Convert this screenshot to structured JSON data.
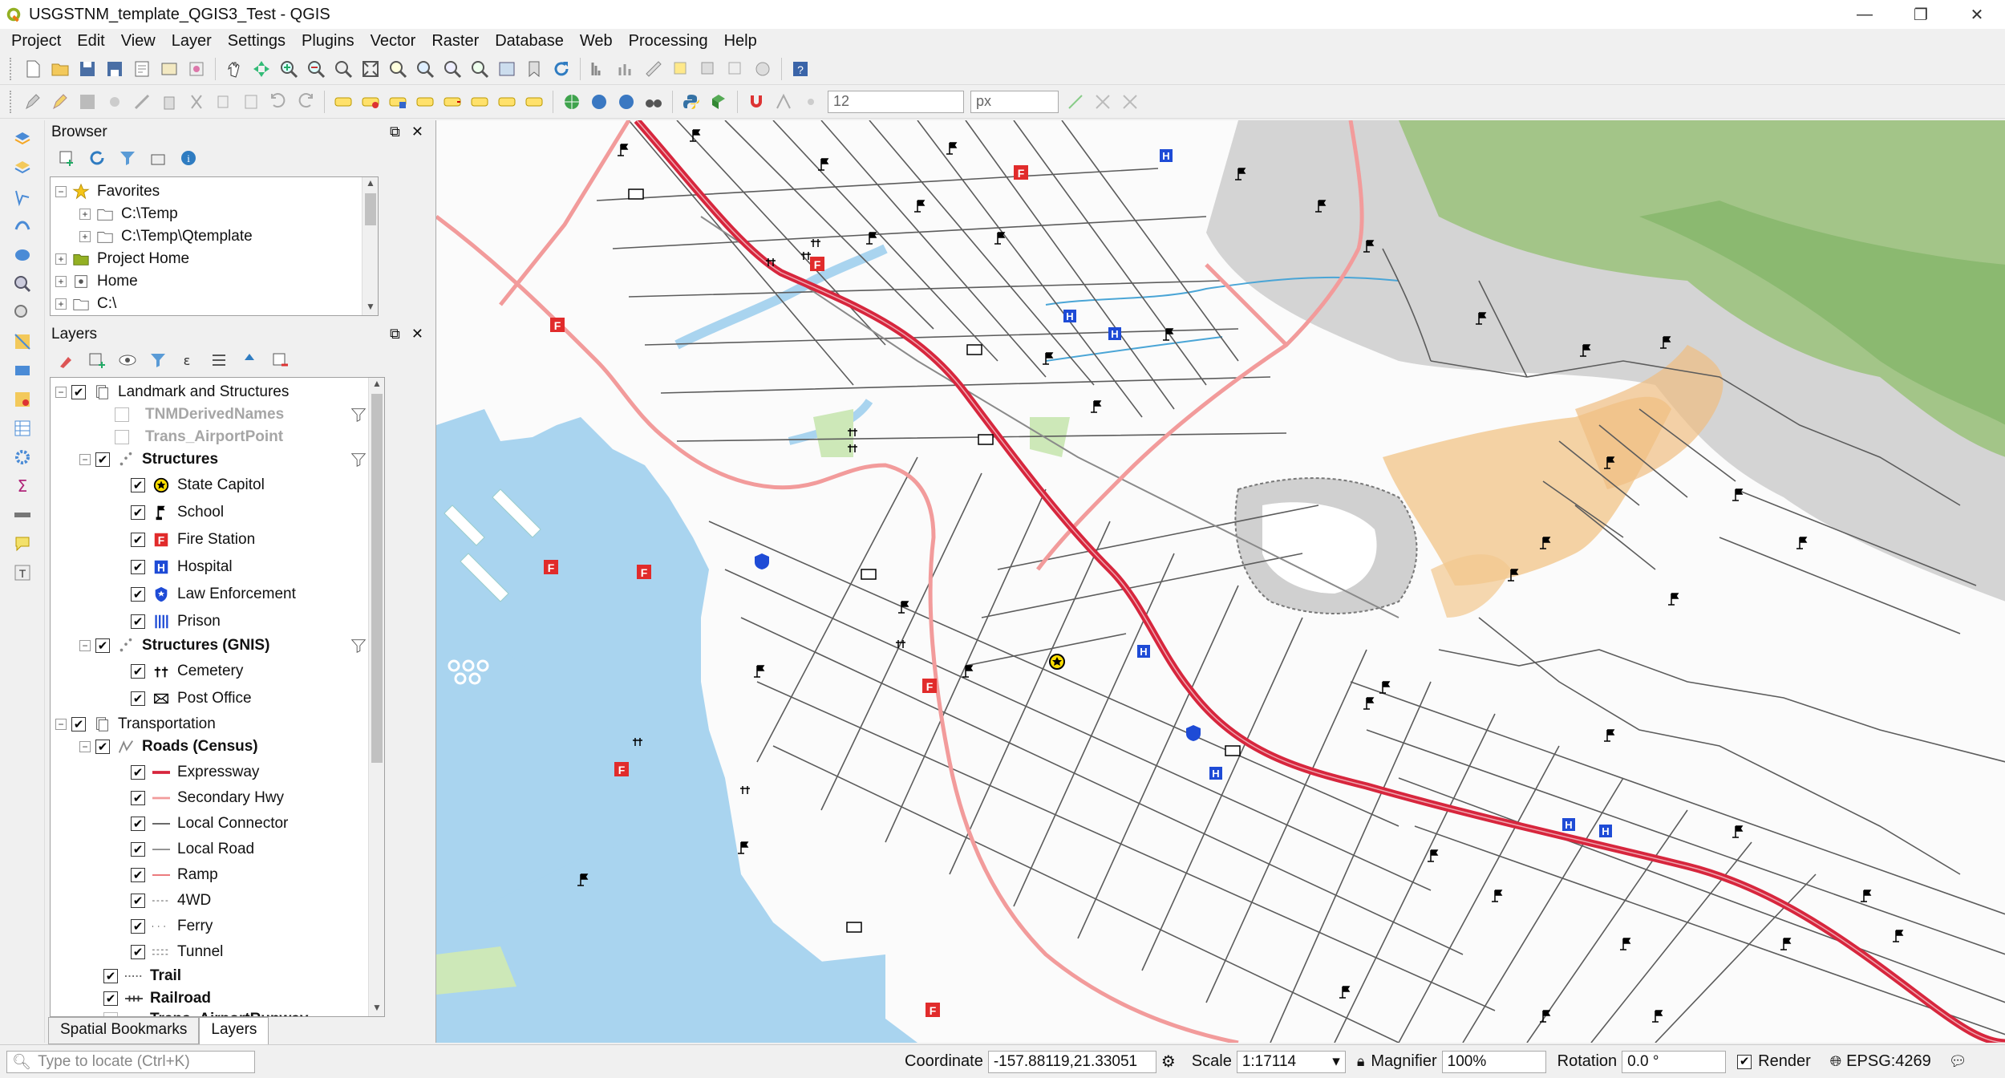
{
  "window": {
    "title": "USGSTNM_template_QGIS3_Test - QGIS",
    "buttons": [
      "minimize",
      "restore",
      "close"
    ]
  },
  "menubar": [
    "Project",
    "Edit",
    "View",
    "Layer",
    "Settings",
    "Plugins",
    "Vector",
    "Raster",
    "Database",
    "Web",
    "Processing",
    "Help"
  ],
  "toolbar2": {
    "snap_tolerance": "12",
    "snap_units": "px"
  },
  "browser": {
    "title": "Browser",
    "items": [
      {
        "label": "Favorites",
        "icon": "star-icon"
      },
      {
        "label": "C:\\Temp",
        "icon": "folder-icon"
      },
      {
        "label": "C:\\Temp\\Qtemplate",
        "icon": "folder-icon"
      },
      {
        "label": "Project Home",
        "icon": "project-home-icon"
      },
      {
        "label": "Home",
        "icon": "home-icon"
      },
      {
        "label": "C:\\",
        "icon": "folder-icon"
      }
    ]
  },
  "layers": {
    "title": "Layers",
    "groups": {
      "landmark": "Landmark and Structures",
      "tnm_derived": "TNMDerivedNames",
      "trans_airport": "Trans_AirportPoint",
      "structures": "Structures",
      "structures_gnis": "Structures (GNIS)",
      "transportation": "Transportation",
      "roads": "Roads (Census)",
      "trail": "Trail",
      "railroad": "Railroad",
      "runway": "Trans_AirportRunway"
    },
    "structures_items": [
      "State Capitol",
      "School",
      "Fire Station",
      "Hospital",
      "Law Enforcement",
      "Prison"
    ],
    "gnis_items": [
      "Cemetery",
      "Post Office"
    ],
    "road_items": [
      "Expressway",
      "Secondary Hwy",
      "Local Connector",
      "Local Road",
      "Ramp",
      "4WD",
      "Ferry",
      "Tunnel"
    ]
  },
  "bottom_tabs": [
    "Spatial Bookmarks",
    "Layers"
  ],
  "status": {
    "locate_placeholder": "Type to locate (Ctrl+K)",
    "coordinate_label": "Coordinate",
    "coordinate": "-157.88119,21.33051",
    "scale_label": "Scale",
    "scale": "1:17114",
    "magnifier_label": "Magnifier",
    "magnifier": "100%",
    "rotation_label": "Rotation",
    "rotation": "0.0 °",
    "render_label": "Render",
    "crs": "EPSG:4269"
  },
  "colors": {
    "expressway": "#d7263d",
    "secondary": "#f29b9b",
    "water": "#a9d4ef",
    "local": "#555555",
    "green": "#9bc87d",
    "urban": "#f2c88f"
  }
}
